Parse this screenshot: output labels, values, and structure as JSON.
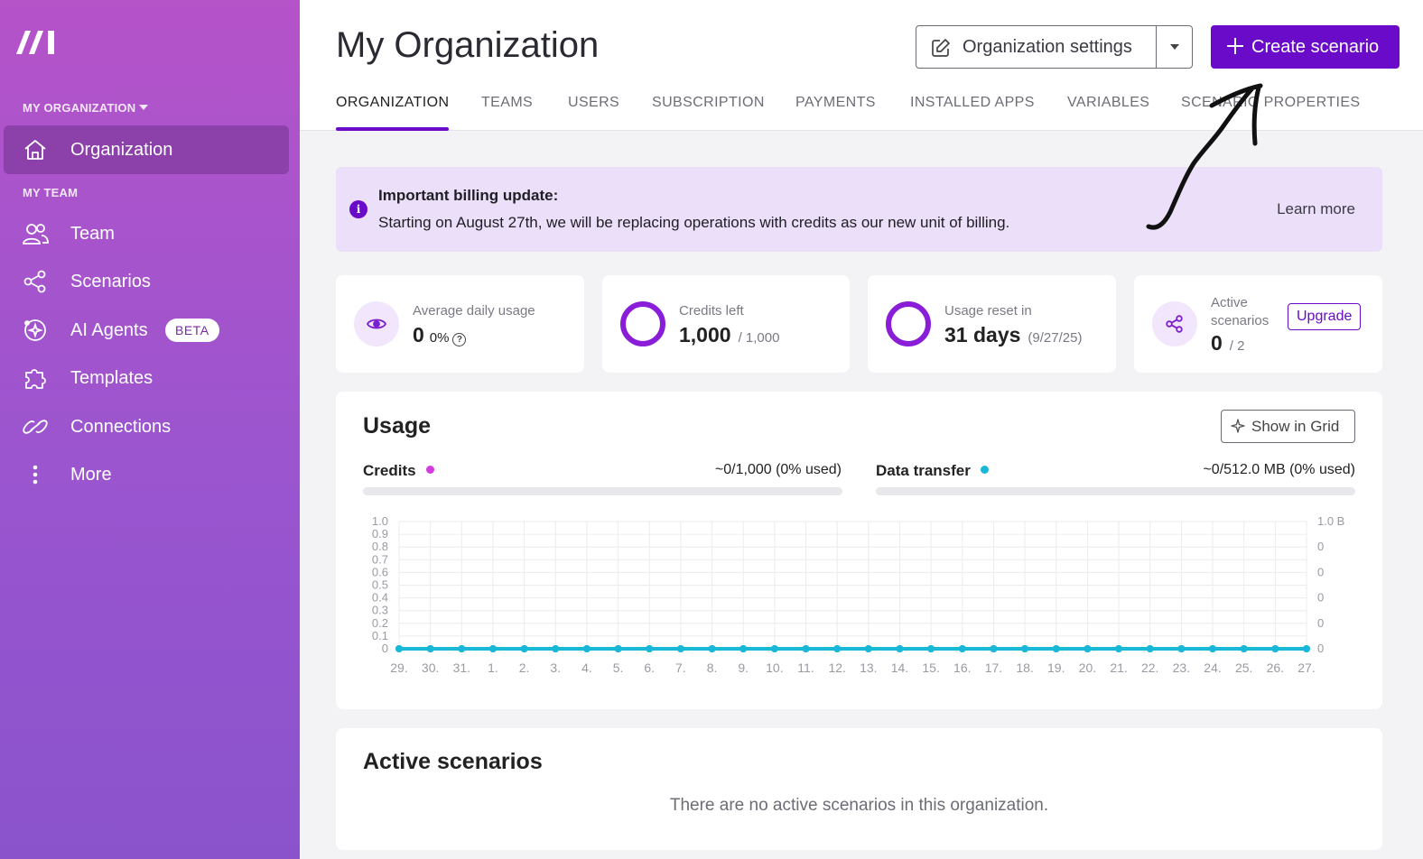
{
  "sidebar": {
    "logo_icon": "make-logo-icon",
    "org_section_label": "MY ORGANIZATION",
    "team_section_label": "MY TEAM",
    "items": [
      {
        "label": "Organization",
        "icon": "home-icon",
        "active": true
      },
      {
        "label": "Team",
        "icon": "users-icon"
      },
      {
        "label": "Scenarios",
        "icon": "share-nodes-icon"
      },
      {
        "label": "AI Agents",
        "icon": "ai-agent-icon",
        "badge": "BETA"
      },
      {
        "label": "Templates",
        "icon": "puzzle-icon"
      },
      {
        "label": "Connections",
        "icon": "link-icon"
      },
      {
        "label": "More",
        "icon": "more-vertical-icon"
      }
    ]
  },
  "header": {
    "title": "My Organization",
    "org_settings_label": "Organization settings",
    "create_label": "Create scenario",
    "tabs": [
      "ORGANIZATION",
      "TEAMS",
      "USERS",
      "SUBSCRIPTION",
      "PAYMENTS",
      "INSTALLED APPS",
      "VARIABLES",
      "SCENARIO PROPERTIES"
    ],
    "active_tab": "ORGANIZATION"
  },
  "banner": {
    "title": "Important billing update:",
    "text": "Starting on August 27th, we will be replacing operations with credits as our new unit of billing.",
    "link": "Learn more"
  },
  "stats": {
    "avg_daily": {
      "label": "Average daily usage",
      "value": "0",
      "pct": "0%"
    },
    "credits": {
      "label": "Credits left",
      "value": "1,000",
      "sub": "/ 1,000"
    },
    "reset": {
      "label": "Usage reset in",
      "value": "31 days",
      "sub": "(9/27/25)"
    },
    "active": {
      "label_line1": "Active",
      "label_line2": "scenarios",
      "value": "0",
      "sub": "/ 2",
      "upgrade": "Upgrade"
    }
  },
  "usage": {
    "title": "Usage",
    "show_grid": "Show in Grid",
    "credits_label": "Credits",
    "credits_value": "~0/1,000 (0% used)",
    "credits_fraction": 0,
    "data_label": "Data transfer",
    "data_value": "~0/512.0 MB (0% used)",
    "data_fraction": 0
  },
  "colors": {
    "accent": "#6a0bc9",
    "credits_dot": "#d63be0",
    "data_dot": "#1ab8d8",
    "line": "#1ab8d8"
  },
  "chart_data": {
    "type": "line",
    "x": [
      "29.",
      "30.",
      "31.",
      "1.",
      "2.",
      "3.",
      "4.",
      "5.",
      "6.",
      "7.",
      "8.",
      "9.",
      "10.",
      "11.",
      "12.",
      "13.",
      "14.",
      "15.",
      "16.",
      "17.",
      "18.",
      "19.",
      "20.",
      "21.",
      "22.",
      "23.",
      "24.",
      "25.",
      "26.",
      "27."
    ],
    "series": [
      {
        "values": [
          0,
          0,
          0,
          0,
          0,
          0,
          0,
          0,
          0,
          0,
          0,
          0,
          0,
          0,
          0,
          0,
          0,
          0,
          0,
          0,
          0,
          0,
          0,
          0,
          0,
          0,
          0,
          0,
          0,
          0
        ]
      },
      {
        "values": [
          0,
          0,
          0,
          0,
          0,
          0,
          0,
          0,
          0,
          0,
          0,
          0,
          0,
          0,
          0,
          0,
          0,
          0,
          0,
          0,
          0,
          0,
          0,
          0,
          0,
          0,
          0,
          0,
          0,
          0
        ]
      }
    ],
    "y_ticks_left": [
      "0",
      "0.1",
      "0.2",
      "0.3",
      "0.4",
      "0.5",
      "0.6",
      "0.7",
      "0.8",
      "0.9",
      "1.0"
    ],
    "y_ticks_right": [
      "0",
      "0",
      "0",
      "0",
      "0",
      "1.0 B"
    ],
    "ylim": [
      0,
      1
    ],
    "grid": true
  },
  "active_scenarios": {
    "title": "Active scenarios",
    "empty_text": "There are no active scenarios in this organization."
  }
}
